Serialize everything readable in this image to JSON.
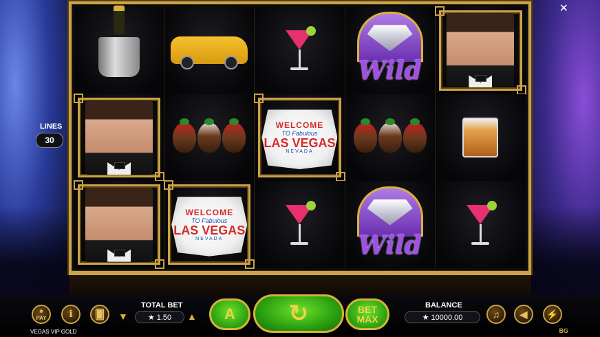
{
  "game": {
    "name": "VEGAS VIP GOLD",
    "provider_badge": "BG"
  },
  "lines": {
    "label": "LINES",
    "value": "30"
  },
  "reels": [
    [
      "champagne-bucket",
      "man",
      "man"
    ],
    [
      "limousine",
      "strawberries",
      "vegas-sign"
    ],
    [
      "cocktail",
      "vegas-sign",
      "cocktail"
    ],
    [
      "wild",
      "strawberries",
      "wild"
    ],
    [
      "man",
      "whisky",
      "cocktail"
    ]
  ],
  "symbols": {
    "wild_text": "Wild",
    "vegas_welcome": "WELCOME",
    "vegas_to": "TO Fabulous",
    "vegas_las": "LAS VEGAS",
    "vegas_nevada": "NEVADA"
  },
  "bet": {
    "label": "TOTAL BET",
    "value": "★ 1.50"
  },
  "balance": {
    "label": "BALANCE",
    "value": "★ 10000.00"
  },
  "buttons": {
    "pay": "PAY",
    "info": "i",
    "autoplay": "A",
    "bet_max_line1": "BET",
    "bet_max_line2": "MAX"
  },
  "colors": {
    "gold": "#c9a24a",
    "spin_green": "#2aa010",
    "wild_purple": "#a24fe8"
  }
}
